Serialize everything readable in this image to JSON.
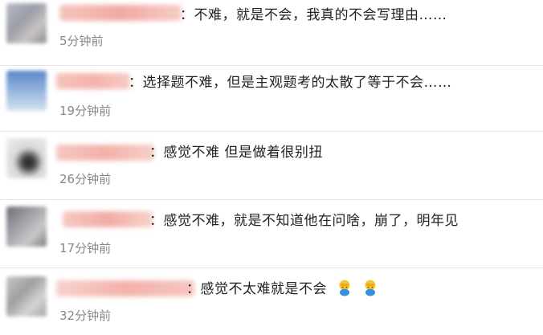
{
  "comments": [
    {
      "text": "：不难，就是不会，我真的不会写理由……",
      "time": "5分钟前"
    },
    {
      "text": "：选择题不难，但是主观题考的太散了等于不会……",
      "time": "19分钟前"
    },
    {
      "text": "：感觉不难 但是做着很别扭",
      "time": "26分钟前"
    },
    {
      "text": "：感觉不难，就是不知道他在问啥，崩了，明年见",
      "time": "17分钟前"
    },
    {
      "text": "：感觉不太难就是不会",
      "time": "32分钟前",
      "emojis": [
        "facepalm-emoji",
        "facepalm-emoji"
      ]
    }
  ],
  "colors": {
    "name_blur": "#f3b6b0",
    "time": "#888888",
    "divider": "#e6e6e6"
  }
}
